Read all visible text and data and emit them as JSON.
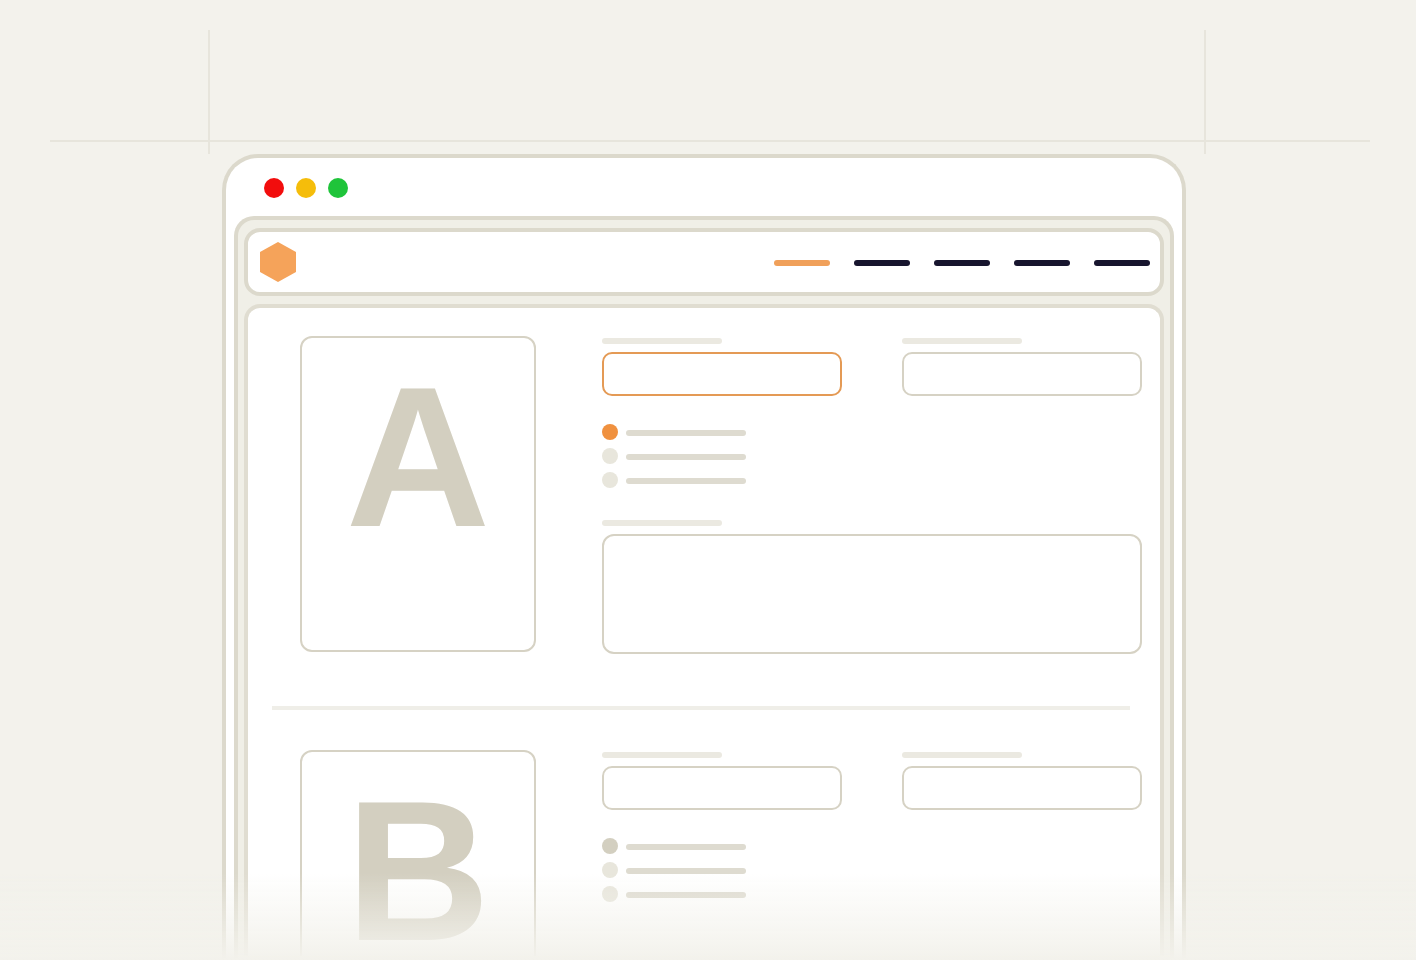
{
  "window": {
    "controls": [
      {
        "color": "#f20d0d"
      },
      {
        "color": "#f5bd0a"
      },
      {
        "color": "#1fc43a"
      }
    ]
  },
  "nav": {
    "items": [
      {
        "selected": true
      },
      {
        "selected": false
      },
      {
        "selected": false
      },
      {
        "selected": false
      },
      {
        "selected": false
      }
    ]
  },
  "sections": [
    {
      "letter": "A",
      "active": true,
      "fields": [
        {
          "focused": true
        },
        {
          "focused": false
        }
      ],
      "options": [
        {
          "selected": true
        },
        {
          "selected": false
        },
        {
          "selected": false
        }
      ],
      "textarea": true
    },
    {
      "letter": "B",
      "active": false,
      "fields": [
        {
          "focused": false
        },
        {
          "focused": false
        }
      ],
      "options": [
        {
          "selected": true
        },
        {
          "selected": false
        },
        {
          "selected": false
        }
      ]
    }
  ]
}
